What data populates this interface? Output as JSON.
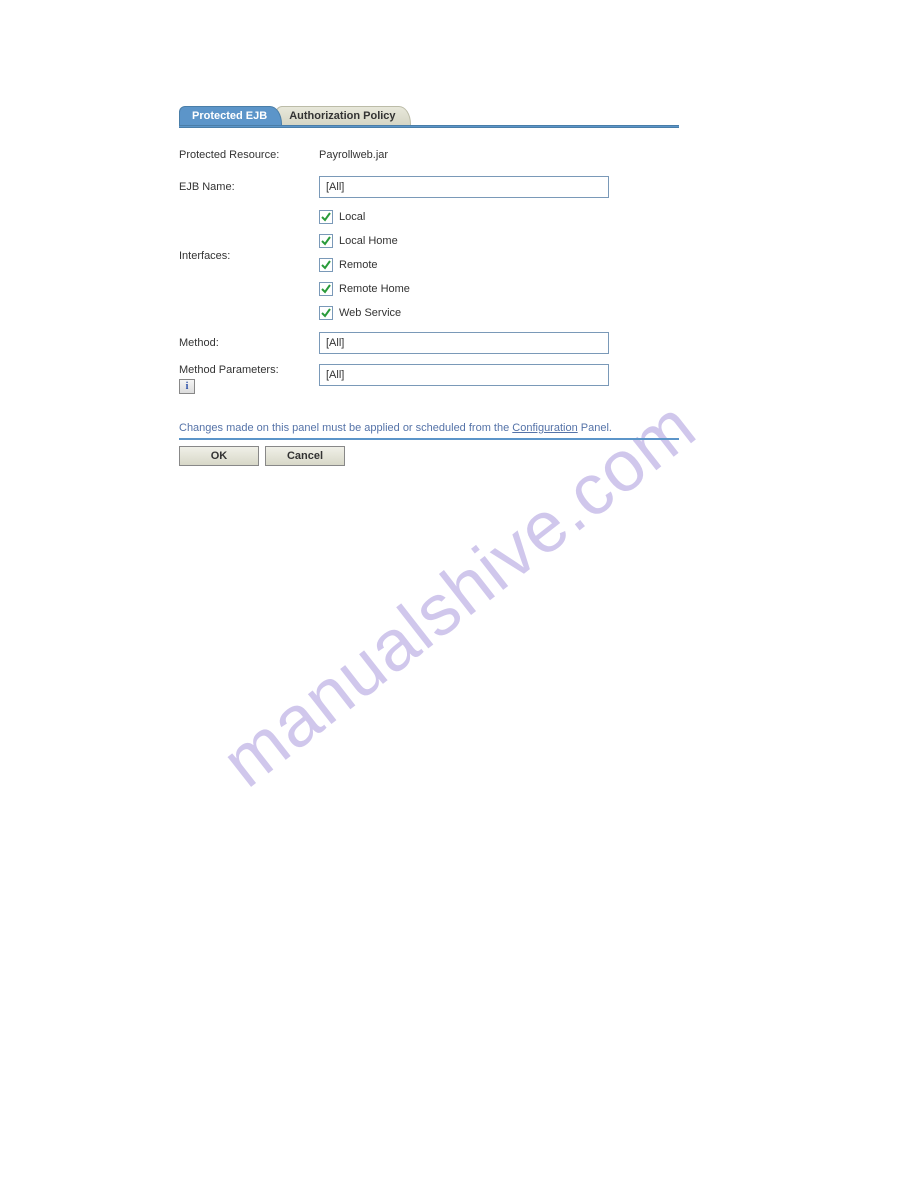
{
  "tabs": {
    "active": "Protected EJB",
    "inactive": "Authorization Policy"
  },
  "form": {
    "protected_resource_label": "Protected Resource:",
    "protected_resource_value": "Payrollweb.jar",
    "ejb_name_label": "EJB Name:",
    "ejb_name_value": "[All]",
    "interfaces_label": "Interfaces:",
    "interfaces": [
      {
        "label": "Local",
        "checked": true
      },
      {
        "label": "Local Home",
        "checked": true
      },
      {
        "label": "Remote",
        "checked": true
      },
      {
        "label": "Remote Home",
        "checked": true
      },
      {
        "label": "Web Service",
        "checked": true
      }
    ],
    "method_label": "Method:",
    "method_value": "[All]",
    "method_params_label": "Method Parameters:",
    "method_params_value": "[All]"
  },
  "notice": {
    "prefix": "Changes made on this panel must be applied or scheduled from the ",
    "link": "Configuration",
    "suffix": " Panel."
  },
  "buttons": {
    "ok": "OK",
    "cancel": "Cancel"
  },
  "watermark": "manualshive.com"
}
